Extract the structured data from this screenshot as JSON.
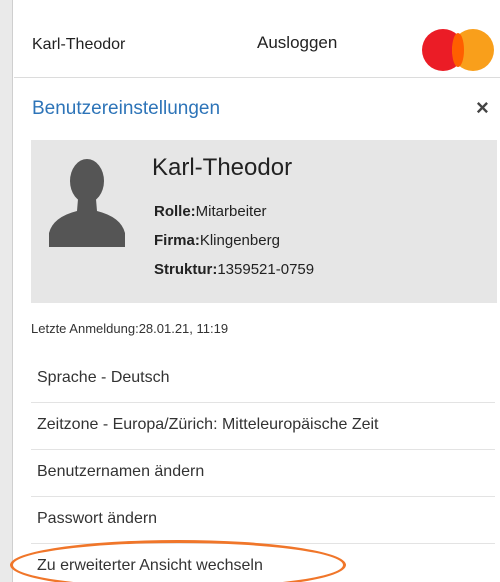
{
  "header": {
    "user_name": "Karl-Theodor",
    "logout_label": "Ausloggen"
  },
  "settings": {
    "title": "Benutzereinstellungen",
    "close_symbol": "×"
  },
  "profile": {
    "name": "Karl-Theodor",
    "role_label": "Rolle:",
    "role_value": "Mitarbeiter",
    "company_label": "Firma:",
    "company_value": "Klingenberg",
    "structure_label": "Struktur:",
    "structure_value": "1359521-0759"
  },
  "last_login": "Letzte Anmeldung:28.01.21, 11:19",
  "menu": {
    "items": [
      {
        "label": "Sprache - Deutsch"
      },
      {
        "label": "Zeitzone - Europa/Zürich: Mitteleuropäische Zeit"
      },
      {
        "label": "Benutzernamen ändern"
      },
      {
        "label": "Passwort ändern"
      },
      {
        "label": "Zu erweiterter Ansicht wechseln"
      }
    ]
  },
  "colors": {
    "accent_blue": "#2d74b8",
    "card_bg": "#e6e6e6",
    "highlight_orange": "#f0762a",
    "mastercard_red": "#eb1c26",
    "mastercard_orange": "#f99f1b"
  },
  "icons": {
    "avatar": "user-silhouette-icon",
    "logo": "mastercard-logo",
    "close": "close-icon"
  }
}
